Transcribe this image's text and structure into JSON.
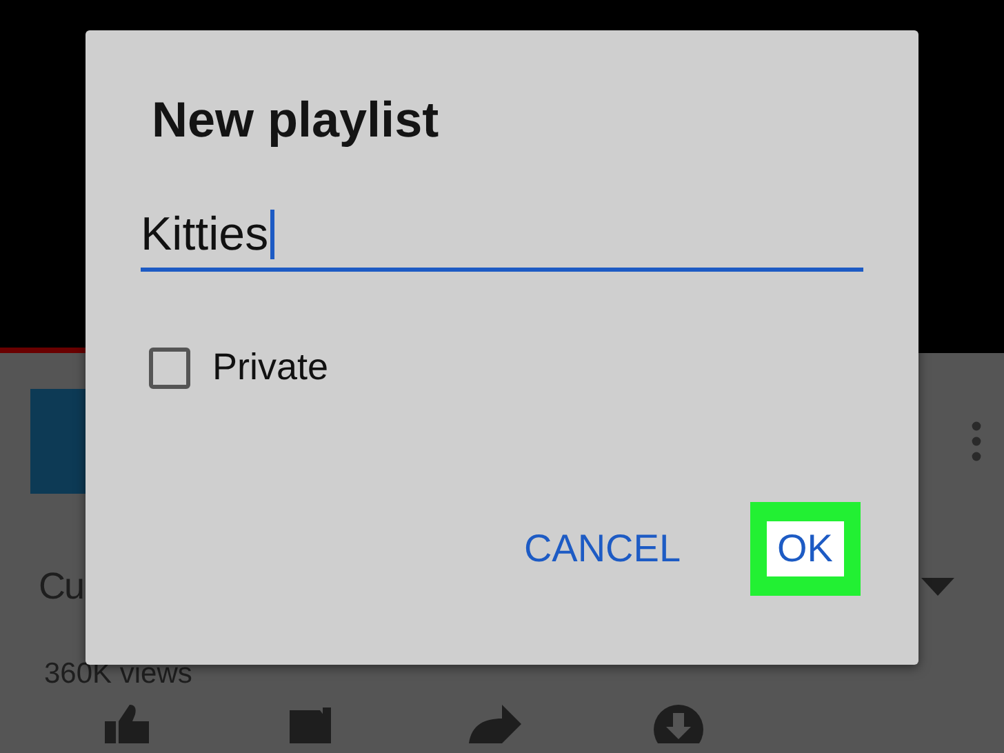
{
  "video_page": {
    "title": "Cu",
    "views": "360K views"
  },
  "dialog": {
    "title": "New playlist",
    "name_field": {
      "value": "Kitties",
      "focused": true
    },
    "private_checkbox": {
      "label": "Private",
      "checked": false
    },
    "buttons": [
      {
        "label": "CANCEL",
        "highlighted": false
      },
      {
        "label": "OK",
        "highlighted": true
      }
    ]
  }
}
